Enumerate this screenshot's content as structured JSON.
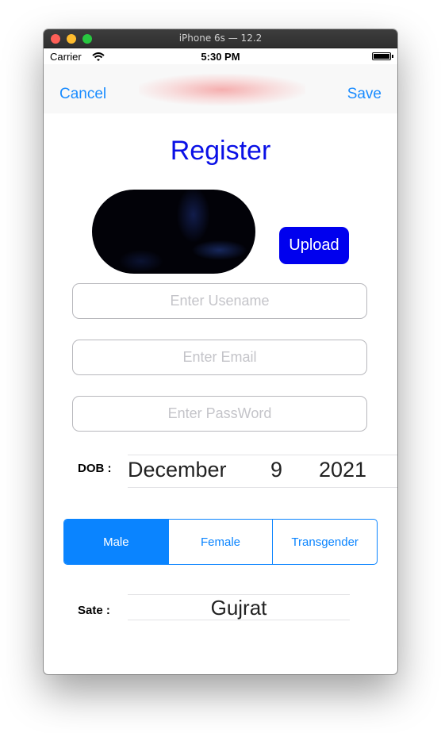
{
  "window": {
    "title": "iPhone 6s — 12.2"
  },
  "status_bar": {
    "carrier": "Carrier",
    "time": "5:30 PM"
  },
  "nav": {
    "cancel_label": "Cancel",
    "save_label": "Save"
  },
  "form": {
    "title": "Register",
    "upload_label": "Upload",
    "username_placeholder": "Enter Usename",
    "email_placeholder": "Enter Email",
    "password_placeholder": "Enter PassWord",
    "dob": {
      "label": "DOB :",
      "month": "December",
      "day": "9",
      "year": "2021"
    },
    "gender": {
      "options": [
        {
          "label": "Male",
          "selected": true
        },
        {
          "label": "Female",
          "selected": false
        },
        {
          "label": "Transgender",
          "selected": false
        }
      ]
    },
    "state": {
      "label": "Sate :",
      "value": "Gujrat"
    }
  },
  "colors": {
    "accent": "#0a84ff",
    "title": "#0a10e6",
    "upload_button": "#0000ee"
  }
}
